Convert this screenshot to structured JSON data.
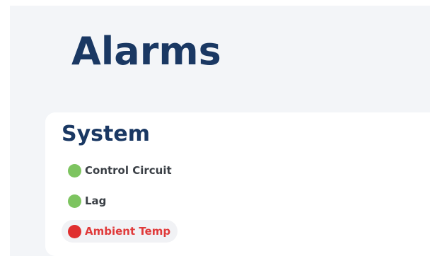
{
  "page": {
    "title": "Alarms"
  },
  "section": {
    "title": "System",
    "alarms": [
      {
        "label": "Control Circuit",
        "status": "ok",
        "color": "#7dc460",
        "icon": "status-dot-icon"
      },
      {
        "label": "Lag",
        "status": "ok",
        "color": "#7dc460",
        "icon": "status-dot-icon"
      },
      {
        "label": "Ambient Temp",
        "status": "alarm",
        "color": "#e02f2f",
        "icon": "status-dot-icon"
      }
    ]
  },
  "colors": {
    "heading": "#1a3863",
    "ok": "#7dc460",
    "alarm": "#e02f2f",
    "alarm_text": "#e03a3a",
    "background": "#f3f5f8"
  }
}
